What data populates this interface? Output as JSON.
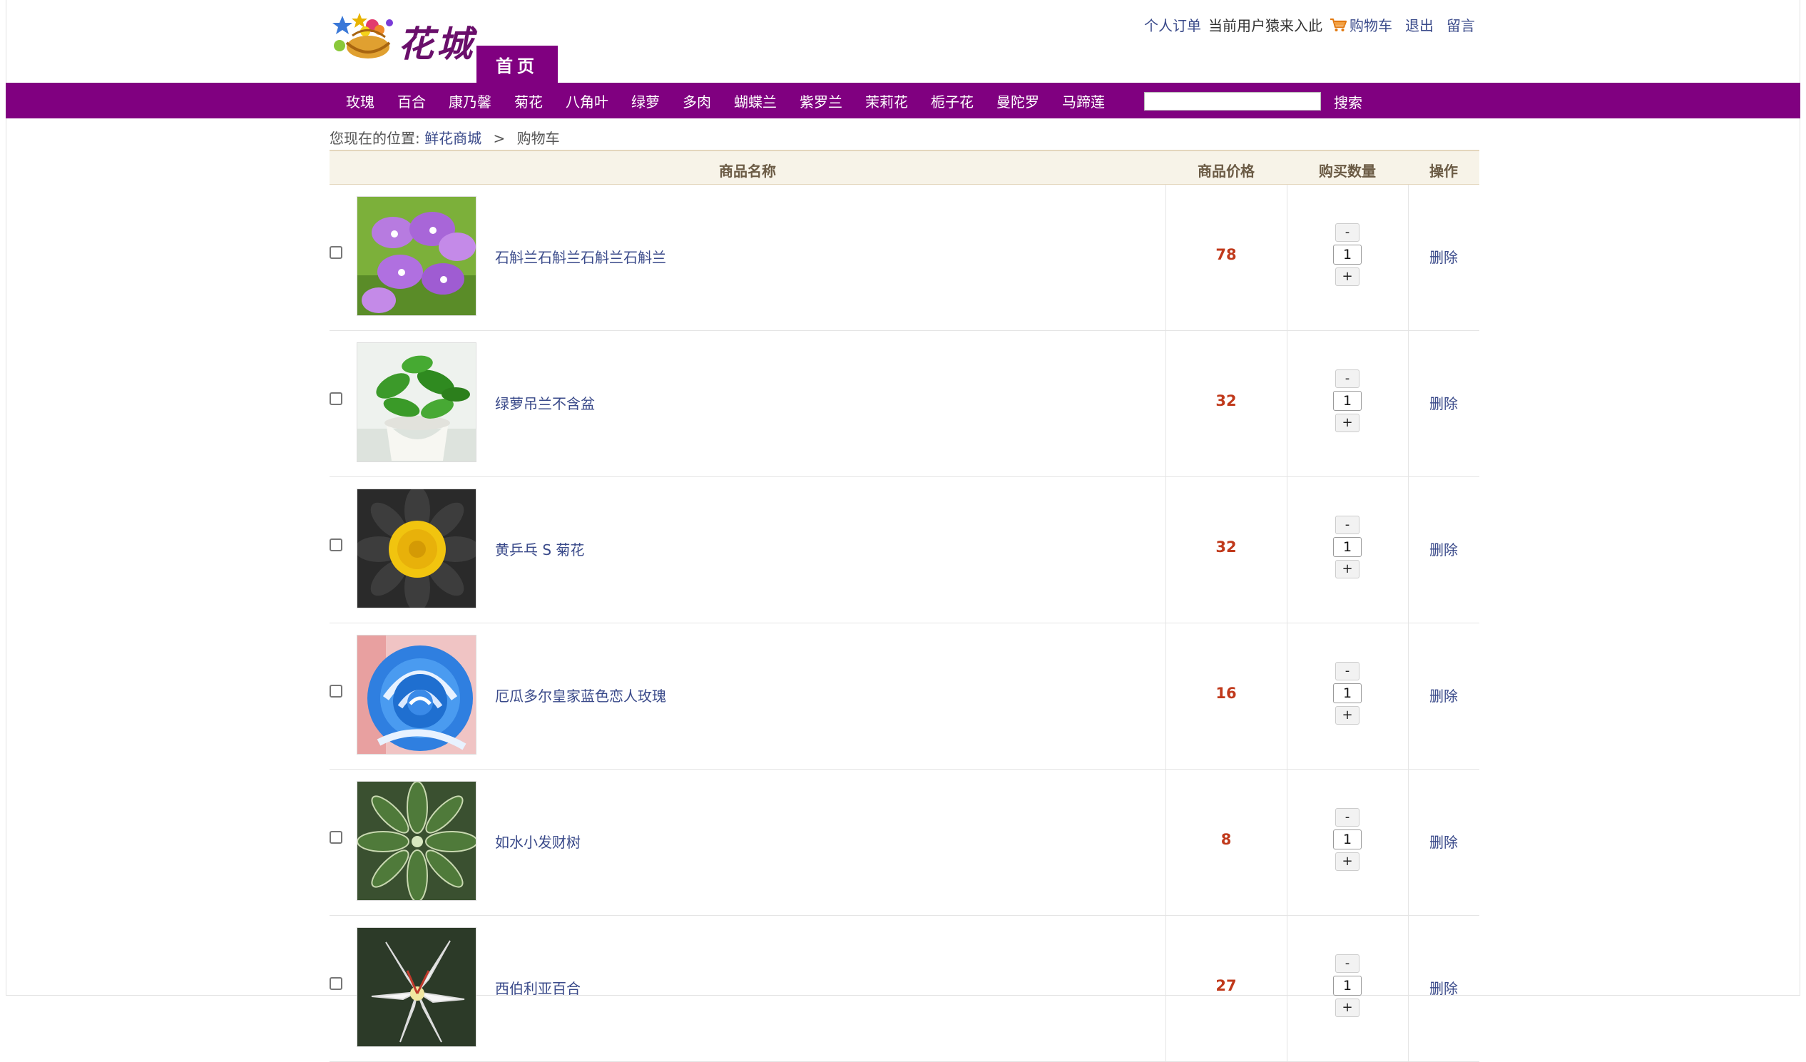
{
  "header": {
    "logo_text": "花城",
    "home_tab": "首页",
    "orders_link": "个人订单",
    "current_user_label": "当前用户猿来入此",
    "cart_link": "购物车",
    "logout_link": "退出",
    "message_link": "留言"
  },
  "nav": {
    "items": [
      "玫瑰",
      "百合",
      "康乃馨",
      "菊花",
      "八角叶",
      "绿萝",
      "多肉",
      "蝴蝶兰",
      "紫罗兰",
      "茉莉花",
      "栀子花",
      "曼陀罗",
      "马蹄莲"
    ],
    "search_value": "",
    "search_button": "搜索"
  },
  "breadcrumb": {
    "prefix": "您现在的位置:",
    "home": "鲜花商城",
    "separator": ">",
    "current": "购物车"
  },
  "cart": {
    "headers": {
      "name": "商品名称",
      "price": "商品价格",
      "qty": "购买数量",
      "op": "操作"
    },
    "minus_label": "-",
    "plus_label": "+",
    "delete_label": "删除",
    "rows": [
      {
        "name": "石斛兰石斛兰石斛兰石斛兰",
        "price": "78",
        "qty": "1"
      },
      {
        "name": "绿萝吊兰不含盆",
        "price": "32",
        "qty": "1"
      },
      {
        "name": "黄乒乓 S 菊花",
        "price": "32",
        "qty": "1"
      },
      {
        "name": "厄瓜多尔皇家蓝色恋人玫瑰",
        "price": "16",
        "qty": "1"
      },
      {
        "name": "如水小发财树",
        "price": "8",
        "qty": "1"
      },
      {
        "name": "西伯利亚百合",
        "price": "27",
        "qty": "1"
      }
    ]
  },
  "colors": {
    "brand_purple": "#800080",
    "link_blue": "#3a4a8a",
    "price_red": "#c0391b",
    "header_bg": "#f7f3e8"
  }
}
